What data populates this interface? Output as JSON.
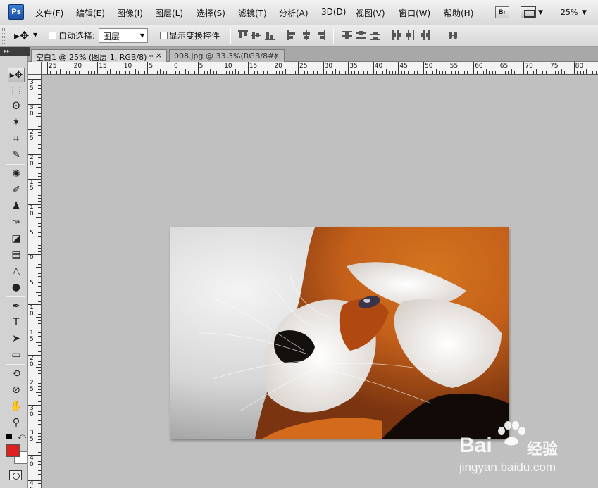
{
  "app": {
    "logo": "Ps"
  },
  "menu": [
    "文件(F)",
    "编辑(E)",
    "图像(I)",
    "图层(L)",
    "选择(S)",
    "滤镜(T)",
    "分析(A)",
    "3D(D)",
    "视图(V)",
    "窗口(W)",
    "帮助(H)"
  ],
  "menubar_right": {
    "bridge_label": "Br",
    "zoom": "25%"
  },
  "options": {
    "tool_icon": "move-tool-icon",
    "auto_select_label": "自动选择:",
    "auto_select_checked": false,
    "auto_select_value": "图层",
    "show_transform_label": "显示变换控件",
    "show_transform_checked": false
  },
  "tabs": [
    {
      "label": "空白1 @ 25% (图层 1, RGB/8) *",
      "active": true,
      "close": "×"
    },
    {
      "label": "008.jpg @ 33.3%(RGB/8#)",
      "active": false,
      "close": "×"
    }
  ],
  "panel_collapse": "▸▸",
  "ruler_h": [
    "25",
    "20",
    "15",
    "10",
    "5",
    "0",
    "5",
    "10",
    "15",
    "20",
    "25",
    "30",
    "35",
    "40",
    "45",
    "50",
    "55",
    "60",
    "65",
    "70",
    "75",
    "80"
  ],
  "ruler_v": [
    "3\n5",
    "3\n0",
    "2\n5",
    "2\n0",
    "1\n5",
    "1\n0",
    "5",
    "0",
    "5",
    "1\n0",
    "1\n5",
    "2\n0",
    "2\n5",
    "3\n0",
    "3\n5",
    "4\n0",
    "4\n5"
  ],
  "tools": [
    {
      "name": "move-tool",
      "glyph": "▸✥",
      "selected": true
    },
    {
      "name": "marquee-tool",
      "glyph": "⬚"
    },
    {
      "name": "lasso-tool",
      "glyph": "ʘ"
    },
    {
      "name": "magic-wand-tool",
      "glyph": "✶"
    },
    {
      "name": "crop-tool",
      "glyph": "⌗"
    },
    {
      "name": "eyedropper-tool",
      "glyph": "✎"
    },
    {
      "name": "spot-healing-tool",
      "glyph": "✺"
    },
    {
      "name": "brush-tool",
      "glyph": "✐"
    },
    {
      "name": "clone-stamp-tool",
      "glyph": "♟"
    },
    {
      "name": "history-brush-tool",
      "glyph": "✑"
    },
    {
      "name": "eraser-tool",
      "glyph": "◪"
    },
    {
      "name": "gradient-tool",
      "glyph": "▤"
    },
    {
      "name": "blur-tool",
      "glyph": "△"
    },
    {
      "name": "dodge-tool",
      "glyph": "●"
    },
    {
      "name": "pen-tool",
      "glyph": "✒"
    },
    {
      "name": "type-tool",
      "glyph": "T"
    },
    {
      "name": "path-selection-tool",
      "glyph": "➤"
    },
    {
      "name": "shape-tool",
      "glyph": "▭"
    },
    {
      "name": "3d-rotate-tool",
      "glyph": "⟲"
    },
    {
      "name": "3d-orbit-tool",
      "glyph": "⊘"
    },
    {
      "name": "hand-tool",
      "glyph": "✋"
    },
    {
      "name": "zoom-tool",
      "glyph": "⚲"
    }
  ],
  "colors": {
    "foreground": "#e0201e",
    "background": "#ffffff",
    "workspace": "#c0c0c0"
  },
  "watermark": {
    "brand": "Bai",
    "brand_cn": "经验",
    "url": "jingyan.baidu.com"
  }
}
